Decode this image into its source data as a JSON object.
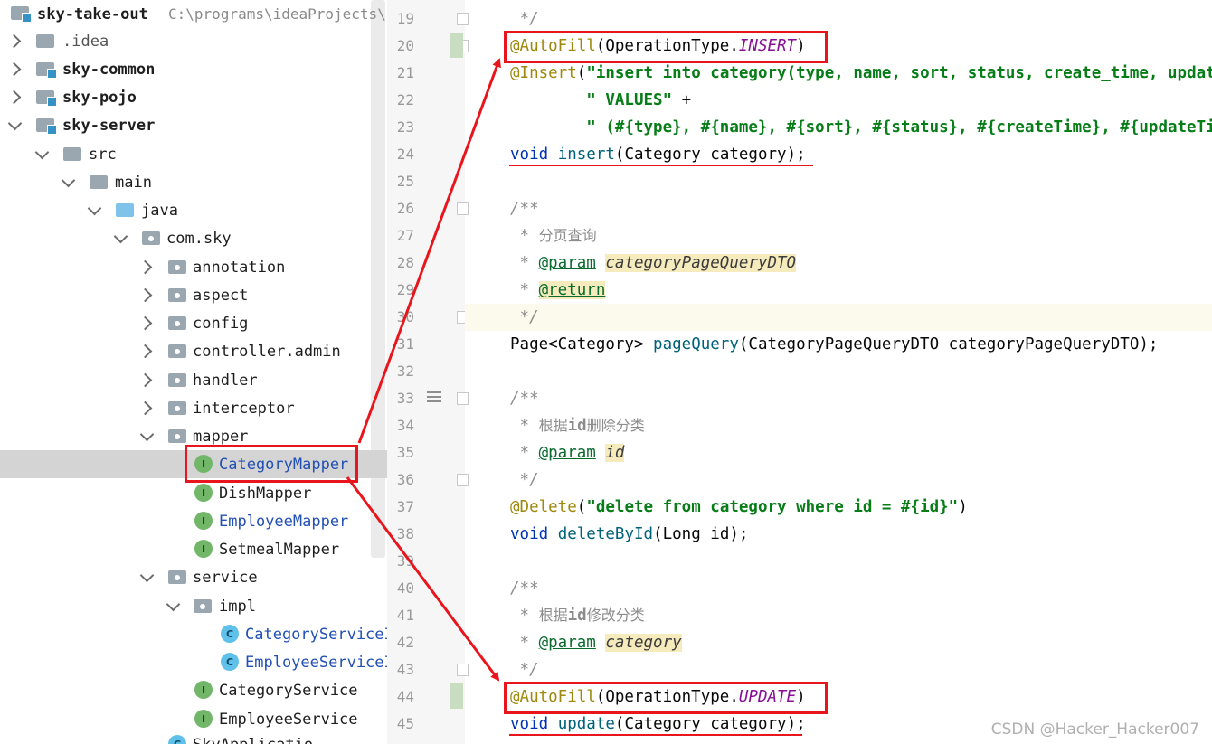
{
  "project_tree": {
    "root": {
      "label": "sky-take-out",
      "path_hint": "C:\\programs\\ideaProjects\\s"
    },
    "items": [
      {
        "label": ".idea"
      },
      {
        "label": "sky-common"
      },
      {
        "label": "sky-pojo"
      },
      {
        "label": "sky-server"
      },
      {
        "label": "src"
      },
      {
        "label": "main"
      },
      {
        "label": "java"
      },
      {
        "label": "com.sky"
      },
      {
        "label": "annotation"
      },
      {
        "label": "aspect"
      },
      {
        "label": "config"
      },
      {
        "label": "controller.admin"
      },
      {
        "label": "handler"
      },
      {
        "label": "interceptor"
      },
      {
        "label": "mapper"
      },
      {
        "label": "CategoryMapper",
        "badge": "I"
      },
      {
        "label": "DishMapper",
        "badge": "I"
      },
      {
        "label": "EmployeeMapper",
        "badge": "I"
      },
      {
        "label": "SetmealMapper",
        "badge": "I"
      },
      {
        "label": "service"
      },
      {
        "label": "impl"
      },
      {
        "label": "CategoryServiceI",
        "badge": "C"
      },
      {
        "label": "EmployeeServiceI",
        "badge": "C"
      },
      {
        "label": "CategoryService",
        "badge": "I"
      },
      {
        "label": "EmployeeService",
        "badge": "I"
      },
      {
        "label": "SkyApplicatio"
      }
    ]
  },
  "editor": {
    "line_numbers": [
      "19",
      "20",
      "21",
      "22",
      "23",
      "24",
      "25",
      "26",
      "27",
      "28",
      "29",
      "30",
      "31",
      "32",
      "33",
      "34",
      "35",
      "36",
      "37",
      "38",
      "39",
      "40",
      "41",
      "42",
      "43",
      "44",
      "45"
    ],
    "code": {
      "l19": " */",
      "l20_ann": "@AutoFill",
      "l20_a": "(OperationType.",
      "l20_c": "INSERT",
      "l20_b": ")",
      "l21_ann": "@Insert",
      "l21_a": "(",
      "l21_s": "\"insert into category(type, name, sort, status, create_time, update_time, create_user, update_user)\"",
      "l22_s": "        \" VALUES\"",
      "l22_a": " +",
      "l23_s": "        \" (#{type}, #{name}, #{sort}, #{status}, #{createTime}, #{updateTime}, #{createUser}, #{updateUser})\"",
      "l23_a": ")",
      "l24_kw": "void",
      "l24_mt": "insert",
      "l24_a": "(Category category);",
      "l26": "/**",
      "l27_a": " * ",
      "l27_cn": "分页查询",
      "l28_a": " * ",
      "l28_tag": "@param",
      "l28_pv": "categoryPageQueryDTO",
      "l29_a": " * ",
      "l29_tag": "@return",
      "l30": " */",
      "l31_a": "Page<Category> ",
      "l31_mt": "pageQuery",
      "l31_b": "(CategoryPageQueryDTO categoryPageQueryDTO);",
      "l33": "/**",
      "l34_a": " * ",
      "l34_cn1": "根据",
      "l34_id": "id",
      "l34_cn2": "删除分类",
      "l35_a": " * ",
      "l35_tag": "@param",
      "l35_pv": "id",
      "l36": " */",
      "l37_ann": "@Delete",
      "l37_a": "(",
      "l37_s": "\"delete from category where id = #{id}\"",
      "l37_b": ")",
      "l38_kw": "void",
      "l38_mt": "deleteById",
      "l38_a": "(Long id);",
      "l40": "/**",
      "l41_a": " * ",
      "l41_cn1": "根据",
      "l41_id": "id",
      "l41_cn2": "修改分类",
      "l42_a": " * ",
      "l42_tag": "@param",
      "l42_pv": "category",
      "l43": " */",
      "l44_ann": "@AutoFill",
      "l44_a": "(OperationType.",
      "l44_c": "UPDATE",
      "l44_b": ")",
      "l45_kw": "void",
      "l45_mt": "update",
      "l45_a": "(Category category);"
    }
  },
  "watermark": "CSDN @Hacker_Hacker007",
  "colors": {
    "annotation_red": "#e8161c",
    "keyword": "#0033b3",
    "string": "#067d17",
    "annotation": "#9e880d",
    "constant": "#871094"
  }
}
